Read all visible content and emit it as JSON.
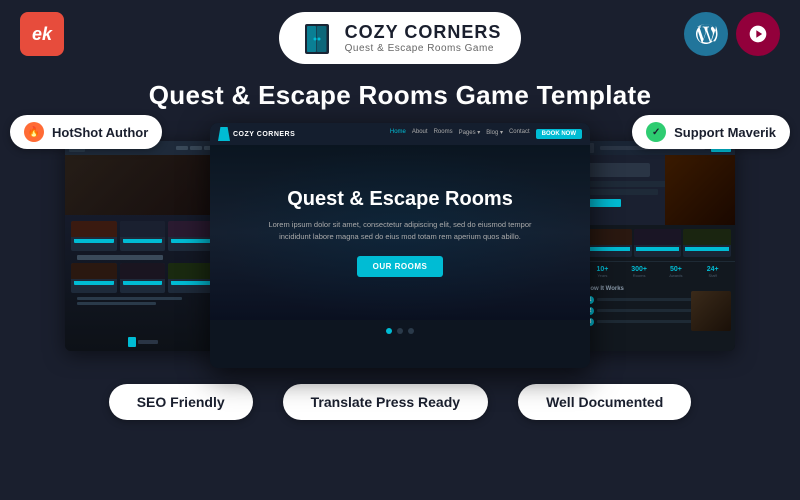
{
  "header": {
    "logo_left_text": "ek",
    "center_name": "COZY CORNERS",
    "center_sub": "Quest & Escape Rooms Game",
    "wp_label": "WordPress",
    "elementor_label": "Elementor"
  },
  "page": {
    "title": "Quest & Escape Rooms Game Template"
  },
  "badges": {
    "hotshot_author": "HotShot Author",
    "support_maverik": "Support Maverik"
  },
  "screenshot_center": {
    "nav_logo": "COZY CORNERS",
    "nav_items": [
      "Home",
      "About",
      "Rooms",
      "Pages",
      "Blog",
      "Contact"
    ],
    "nav_btn": "BOOK NOW",
    "hero_title": "Quest & Escape Rooms",
    "hero_desc": "Lorem ipsum dolor sit amet, consectetur adipiscing elit, sed do eiusmod tempor incididunt labore magna sed do eius mod totam rem aperium quos abillo.",
    "hero_btn": "OUR ROOMS"
  },
  "screenshot_right": {
    "stat1_num": "10+",
    "stat1_label": "Years",
    "stat2_num": "300+",
    "stat2_label": "Rooms",
    "stat3_num": "50+",
    "stat3_label": "Awards",
    "stat4_num": "24+",
    "stat4_label": "Staff",
    "how_title": "How It Works"
  },
  "bottom_badges": {
    "seo": "SEO Friendly",
    "translate": "Translate Press Ready",
    "documented": "Well Documented"
  }
}
